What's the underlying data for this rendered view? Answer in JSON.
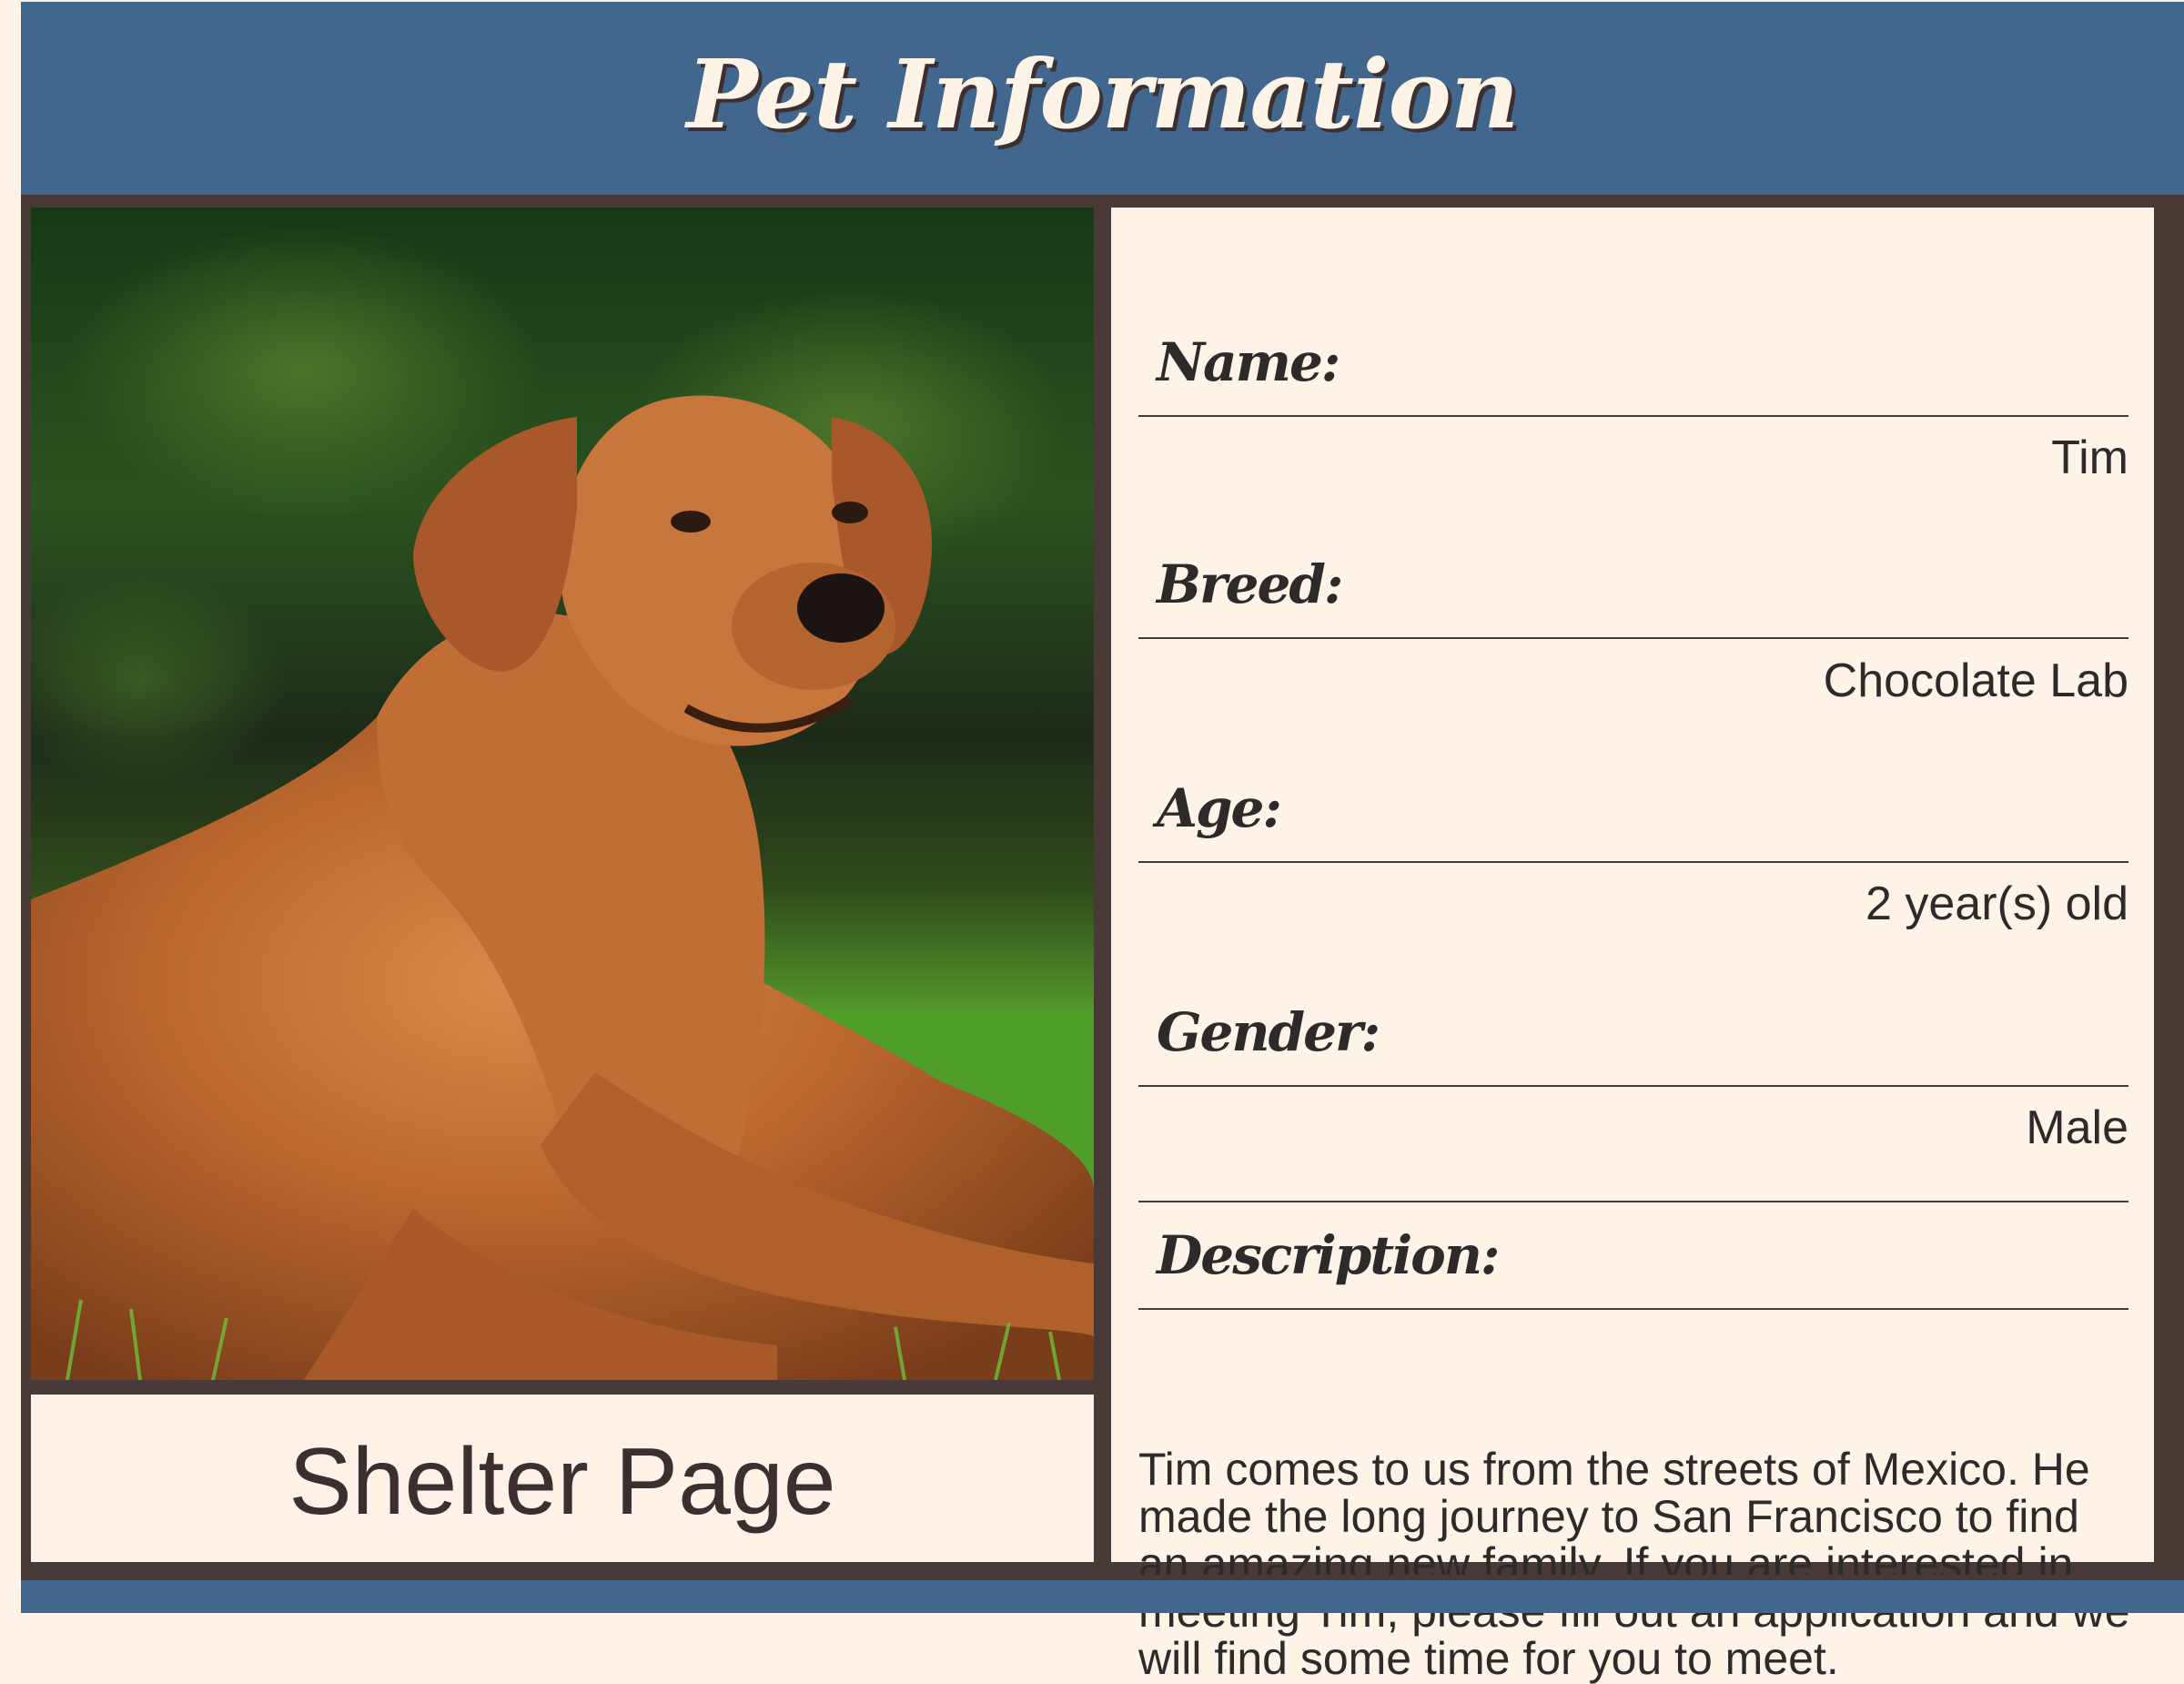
{
  "header": {
    "title": "Pet Information"
  },
  "photo": {
    "alt": "Dog photo"
  },
  "caption": {
    "text": "Shelter Page"
  },
  "fields": {
    "name": {
      "label": "Name:",
      "value": "Tim"
    },
    "breed": {
      "label": "Breed:",
      "value": "Chocolate Lab"
    },
    "age": {
      "label": "Age:",
      "value": "2 year(s) old"
    },
    "gender": {
      "label": "Gender:",
      "value": "Male"
    },
    "description": {
      "label": "Description:",
      "value": "Tim comes to us from the streets of Mexico. He made the long journey to San Francisco to find an amazing new family. If you are interested in meeting Tim, please fill out an application and we will find some time for you to meet."
    }
  },
  "colors": {
    "header_blue": "#42678e",
    "cream": "#fdf3e7",
    "frame_brown": "#4a3a37",
    "text_dark": "#2f2a2a"
  }
}
